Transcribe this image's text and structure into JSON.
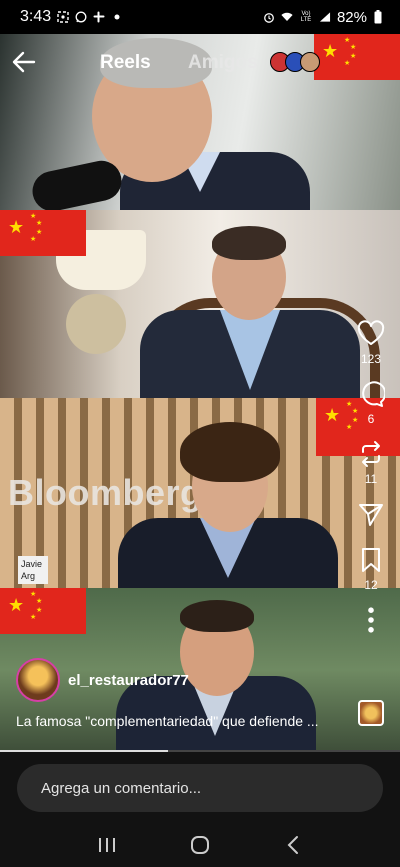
{
  "status_bar": {
    "time": "3:43",
    "left_icons": [
      "screenshot-icon",
      "whatsapp-icon",
      "slack-icon",
      "dot-icon"
    ],
    "right_icons": [
      "alarm-icon",
      "wifi-icon",
      "volte-icon",
      "signal-icon"
    ],
    "volte_label": "Vo) LTE",
    "battery": "82%"
  },
  "header": {
    "back_icon": "arrow-left-icon",
    "tabs": [
      {
        "label": "Reels",
        "active": true
      },
      {
        "label": "Amigos",
        "active": false
      }
    ]
  },
  "video": {
    "overlay_text": "Bloomberg",
    "lower_third": "Javie Arg",
    "flag_color": "#e1261c",
    "star_color": "#ffde00"
  },
  "actions": {
    "like_count": "123",
    "comment_count": "6",
    "repost_count": "11",
    "save_count": "12"
  },
  "author": {
    "username": "el_restaurador77"
  },
  "caption": "La famosa \"complementariedad\" que defiende ...",
  "comment_input": {
    "placeholder": "Agrega un comentario..."
  },
  "nav": {
    "buttons": [
      "recents-icon",
      "home-icon",
      "back-icon"
    ]
  },
  "colors": {
    "background": "#000000",
    "input_bg": "#2b2b2b",
    "avatar_ring": "#d63fa6"
  }
}
